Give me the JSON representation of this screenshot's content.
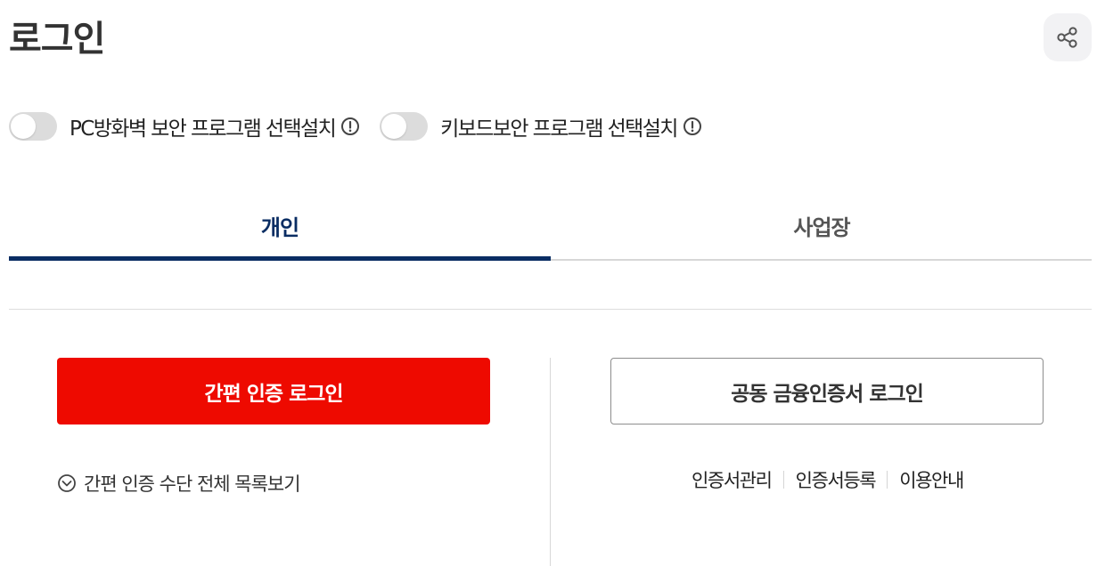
{
  "page": {
    "title": "로그인"
  },
  "security": {
    "firewall_label": "PC방화벽 보안 프로그램 선택설치",
    "keyboard_label": "키보드보안 프로그램 선택설치"
  },
  "tabs": [
    {
      "label": "개인",
      "active": true
    },
    {
      "label": "사업장",
      "active": false
    }
  ],
  "login": {
    "simple_button": "간편 인증 로그인",
    "cert_button": "공동 금융인증서 로그인",
    "view_all_methods": "간편 인증 수단 전체 목록보기",
    "cert_links": [
      "인증서관리",
      "인증서등록",
      "이용안내"
    ]
  },
  "colors": {
    "accent_navy": "#0a2d63",
    "primary_red": "#ee0a00",
    "toggle_off": "#dcdcdc"
  },
  "icons": {
    "share": "share-icon",
    "info": "info-circle-icon",
    "chevron": "chevron-down-circle-icon"
  }
}
